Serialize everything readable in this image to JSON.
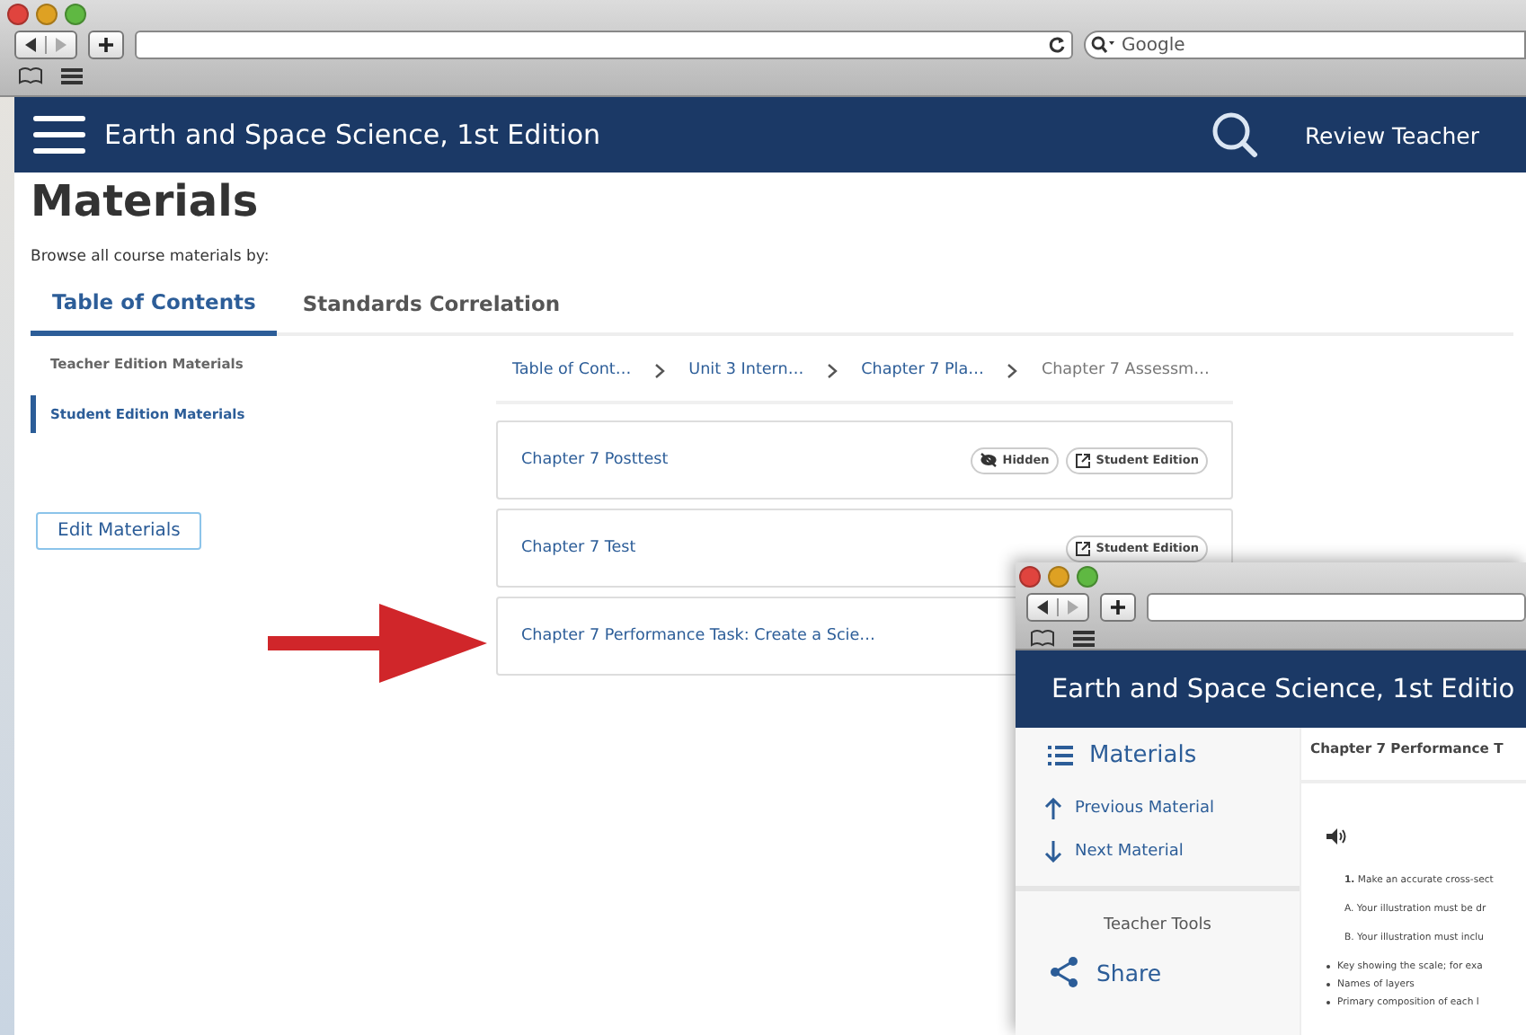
{
  "browser": {
    "search_placeholder": "Google"
  },
  "app_bar": {
    "title": "Earth and Space Science, 1st Edition",
    "user": "Review Teacher"
  },
  "page": {
    "heading": "Materials",
    "browse_label": "Browse all course materials by:"
  },
  "tabs": [
    {
      "label": "Table of Contents",
      "selected": true
    },
    {
      "label": "Standards Correlation",
      "selected": false
    }
  ],
  "sidebar": {
    "items": [
      {
        "label": "Teacher Edition Materials",
        "selected": false
      },
      {
        "label": "Student Edition Materials",
        "selected": true
      }
    ],
    "edit_button": "Edit Materials"
  },
  "breadcrumbs": [
    {
      "label": "Table of Cont…",
      "current": false
    },
    {
      "label": "Unit 3 Intern…",
      "current": false
    },
    {
      "label": "Chapter 7 Pla…",
      "current": false
    },
    {
      "label": "Chapter 7 Assessm…",
      "current": true
    }
  ],
  "materials": [
    {
      "title": "Chapter 7 Posttest",
      "badges": [
        {
          "kind": "hidden",
          "label": "Hidden"
        },
        {
          "kind": "edition",
          "label": "Student Edition"
        }
      ]
    },
    {
      "title": "Chapter 7 Test",
      "badges": [
        {
          "kind": "edition",
          "label": "Student Edition"
        }
      ]
    },
    {
      "title": "Chapter 7 Performance Task: Create a Scie…"
    }
  ],
  "popup_window": {
    "app_title": "Earth and Space Science, 1st Editio",
    "nav_heading": "Materials",
    "nav_links": [
      {
        "kind": "previous",
        "label": "Previous Material"
      },
      {
        "kind": "next",
        "label": "Next Material"
      }
    ],
    "tools_heading": "Teacher Tools",
    "share": "Share",
    "content_title": "Chapter 7 Performance T",
    "paragraphs": [
      "**1.** Make an accurate cross-sect",
      "A. Your illustration must be dr",
      "B. Your illustration must inclu"
    ],
    "bullets": [
      "Key showing the scale; for exa",
      "Names of layers",
      "Primary composition of each l"
    ]
  }
}
